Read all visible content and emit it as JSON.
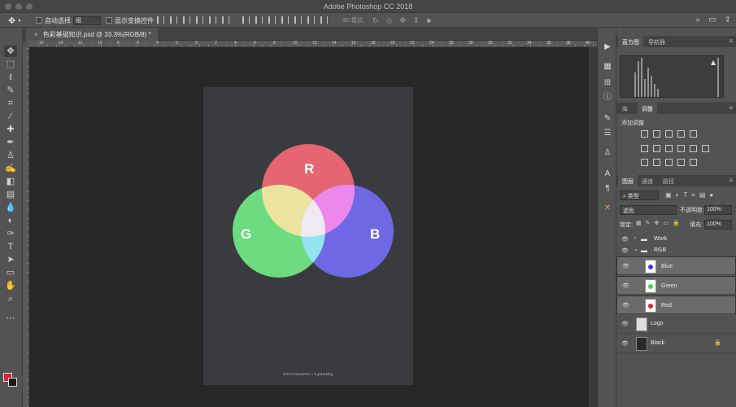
{
  "app": {
    "title": "Adobe Photoshop CC 2018"
  },
  "options": {
    "auto_select_label": "自动选择:",
    "auto_select_value": "组",
    "show_transform_label": "显示变换控件",
    "mode_3d_label": "3D 模式:"
  },
  "document": {
    "tab_label": "色彩基础知识.psd @ 33.3%(RGB/8) *",
    "ruler_ticks": [
      "16",
      "14",
      "12",
      "10",
      "8",
      "6",
      "4",
      "2",
      "0",
      "2",
      "4",
      "6",
      "8",
      "10",
      "12",
      "14",
      "16",
      "18",
      "20",
      "22",
      "24",
      "26",
      "28",
      "30",
      "32",
      "34",
      "36",
      "38",
      "40"
    ]
  },
  "artwork": {
    "letters": {
      "r": "R",
      "g": "G",
      "b": "B"
    },
    "signature_left": "PHOTOGRAPHY /",
    "signature_right": "Lynnsky"
  },
  "colors": {
    "red": "#f03a4b",
    "green": "#46e35c",
    "blue": "#4a3ff0",
    "fg_swatch": "#d9262c"
  },
  "panels": {
    "histogram_tab": "直方图",
    "navigator_tab": "导航器",
    "library_tab": "库",
    "adjustments_tab": "调整",
    "add_adjustment": "添加调整",
    "layers_tab": "图层",
    "channels_tab": "通道",
    "paths_tab": "路径",
    "kind_filter": "类型",
    "blend_mode": "滤色",
    "opacity_label": "不透明度:",
    "opacity_value": "100%",
    "lock_label": "锁定:",
    "fill_label": "填充:",
    "fill_value": "100%"
  },
  "layers": [
    {
      "name": "Work",
      "kind": "group"
    },
    {
      "name": "RGB",
      "kind": "group"
    },
    {
      "name": "Blue",
      "kind": "layer",
      "dot": "#3b3bf0"
    },
    {
      "name": "Green",
      "kind": "layer",
      "dot": "#3fd84c"
    },
    {
      "name": "Red",
      "kind": "layer",
      "dot": "#e02034"
    },
    {
      "name": "Logo",
      "kind": "layer"
    },
    {
      "name": "Black",
      "kind": "layer"
    }
  ]
}
